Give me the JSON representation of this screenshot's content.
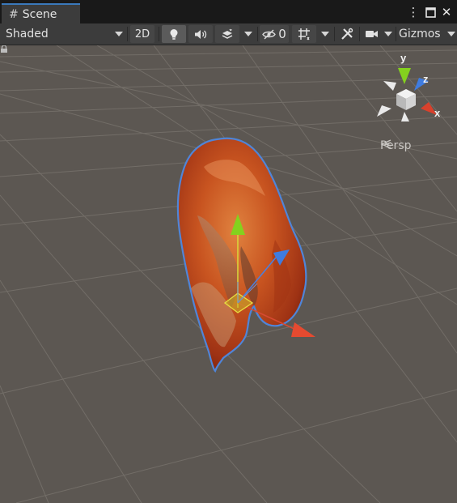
{
  "tab": {
    "icon": "hash-icon",
    "title": "Scene"
  },
  "window_controls": {
    "menu": "⋮",
    "maximize": "□",
    "close": "✕"
  },
  "toolbar": {
    "shading_mode": "Shaded",
    "mode_2d_label": "2D",
    "hidden_count": "0",
    "gizmos_label": "Gizmos"
  },
  "gizmo": {
    "x_label": "x",
    "y_label": "y",
    "z_label": "z",
    "projection_label": "Persp"
  },
  "colors": {
    "tab_accent": "#3a79bb",
    "axis_x": "#d9412c",
    "axis_y": "#84d11e",
    "axis_z": "#3f7ce0",
    "background": "#5c5752"
  }
}
